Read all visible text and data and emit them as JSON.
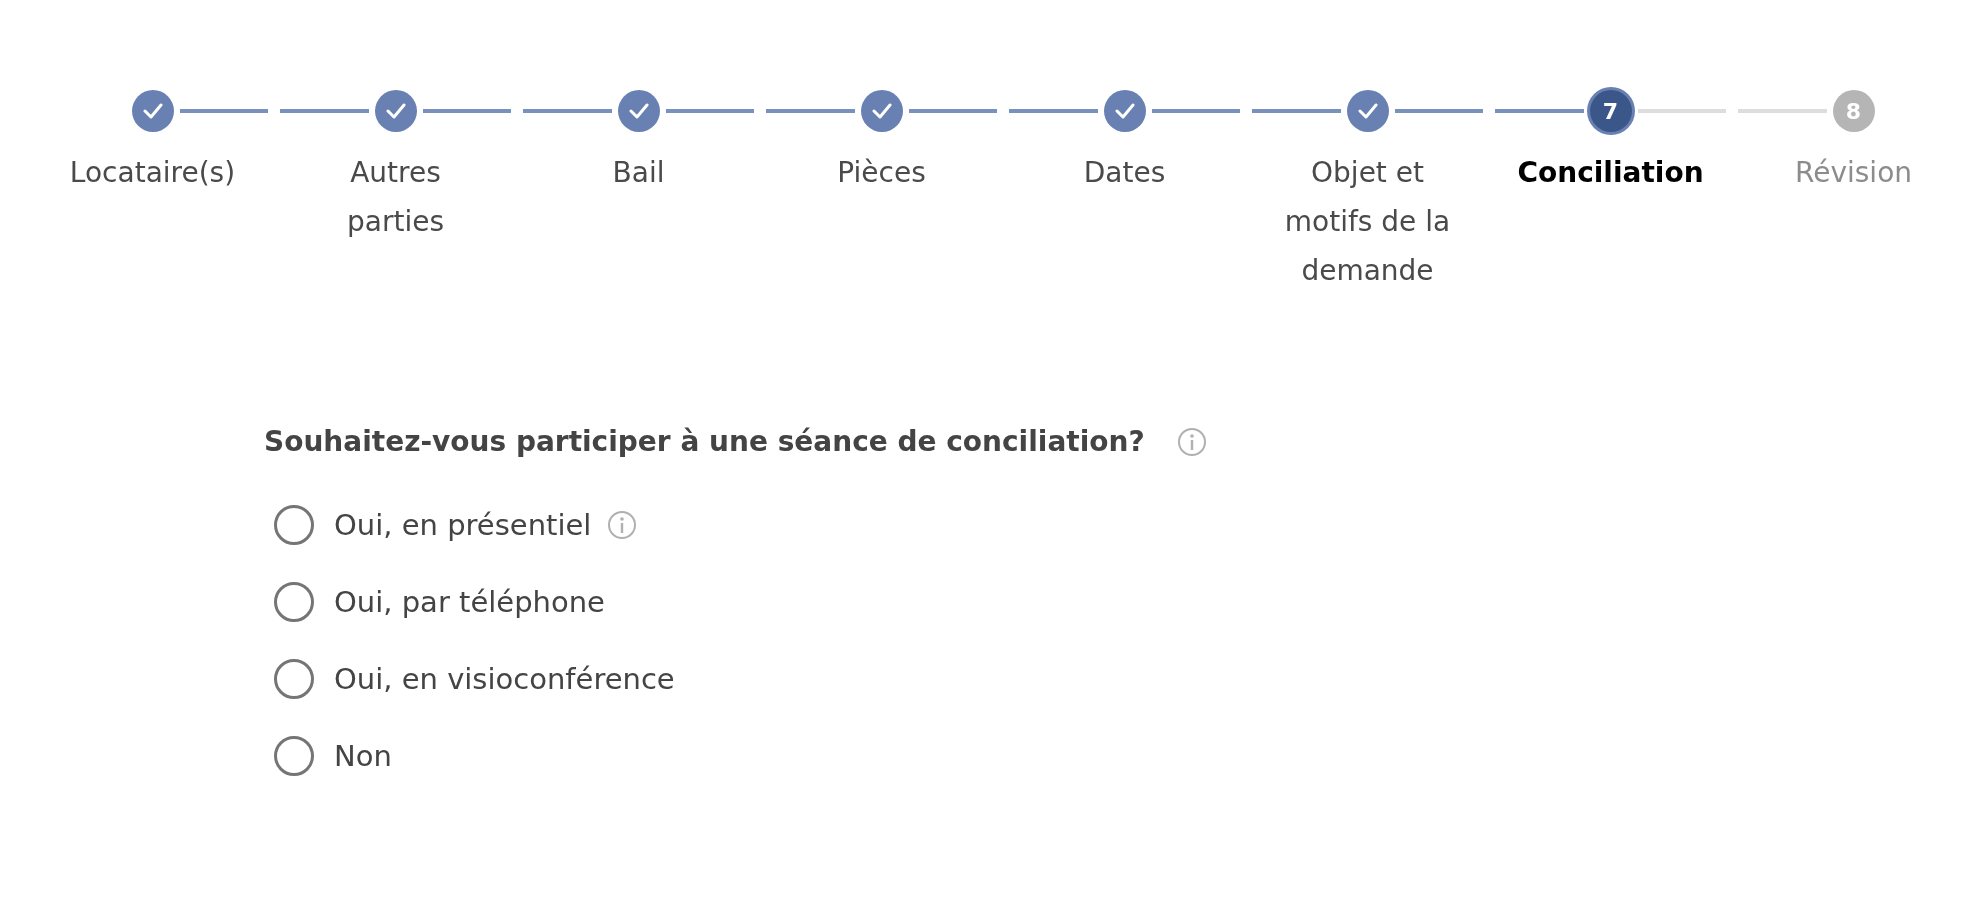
{
  "stepper": {
    "steps": [
      {
        "label": "Locataire(s)",
        "completed": true,
        "current": false
      },
      {
        "label": "Autres parties",
        "completed": true,
        "current": false
      },
      {
        "label": "Bail",
        "completed": true,
        "current": false
      },
      {
        "label": "Pièces",
        "completed": true,
        "current": false
      },
      {
        "label": "Dates",
        "completed": true,
        "current": false
      },
      {
        "label": "Objet et motifs de la demande",
        "completed": true,
        "current": false
      },
      {
        "number": "7",
        "label": "Conciliation",
        "completed": false,
        "current": true
      },
      {
        "number": "8",
        "label": "Révision",
        "completed": false,
        "current": false
      }
    ]
  },
  "question": {
    "text": "Souhaitez-vous participer à une séance de conciliation?",
    "info": true,
    "options": [
      {
        "label": "Oui, en présentiel",
        "info": true,
        "selected": false
      },
      {
        "label": "Oui, par téléphone",
        "info": false,
        "selected": false
      },
      {
        "label": "Oui, en visioconférence",
        "info": false,
        "selected": false
      },
      {
        "label": "Non",
        "info": false,
        "selected": false
      }
    ]
  }
}
